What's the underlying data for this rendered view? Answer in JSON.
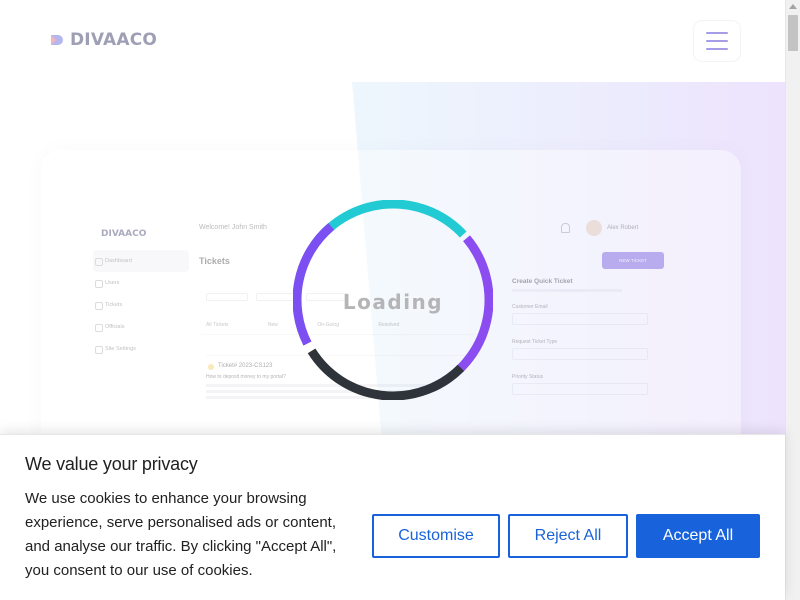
{
  "header": {
    "brand": "DIVAACO",
    "menu_icon": "hamburger-icon"
  },
  "mockup": {
    "brand": "DIVAACO",
    "welcome": "Welcome! John Smith",
    "user_name": "Alex Robert",
    "sidebar": [
      "Dashboard",
      "Users",
      "Tickets",
      "Officials",
      "Site Settings"
    ],
    "page_title": "Tickets",
    "new_ticket": "NEW TICKET",
    "tabs": [
      "All Tickets",
      "New",
      "On-Going",
      "Resolved"
    ],
    "card_title": "Ticket# 2023-CS123",
    "card_subtitle": "How to deposit money to my portal?",
    "panel_title": "Create Quick Ticket",
    "panel_fields": [
      "Customer Email",
      "Request Ticket Type",
      "Priority Status"
    ]
  },
  "loader": {
    "text": "Loading",
    "colors": {
      "top": "#22cbd3",
      "right": "#8b4cf0",
      "bottom": "#2e3439",
      "left": "#7b4ff1"
    }
  },
  "cookie": {
    "title": "We value your privacy",
    "text": "We use cookies to enhance your browsing experience, serve personalised ads or content, and analyse our traffic. By clicking \"Accept All\", you consent to our use of cookies.",
    "customise": "Customise",
    "reject": "Reject All",
    "accept": "Accept All",
    "accent": "#1863dc"
  }
}
